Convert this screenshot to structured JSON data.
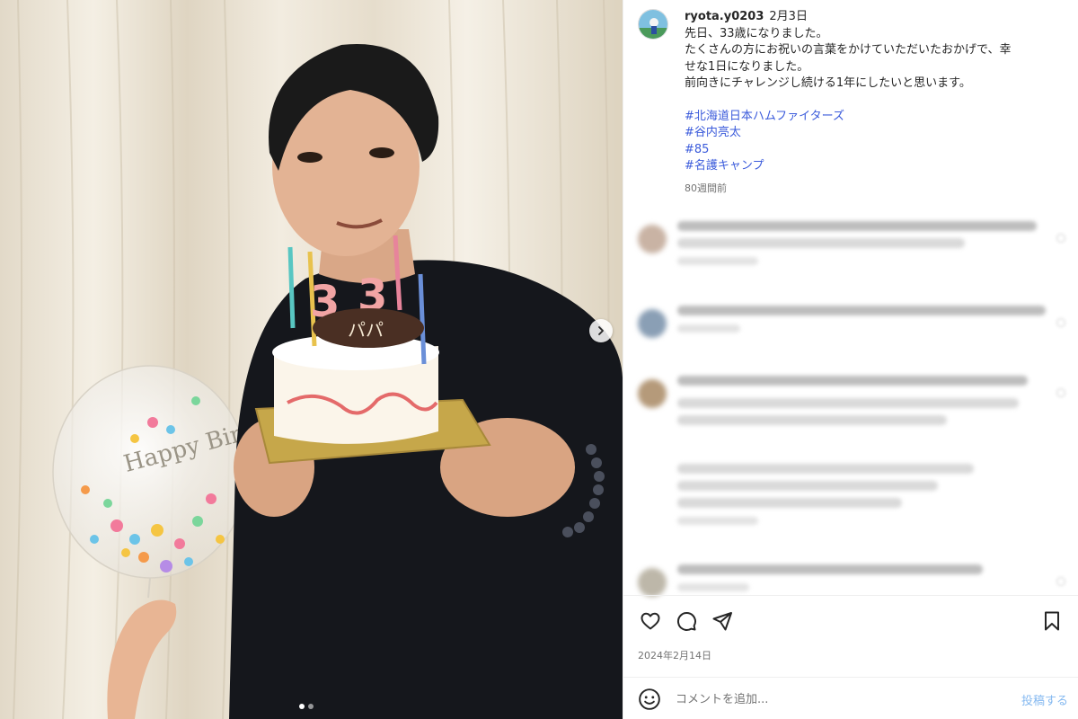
{
  "post": {
    "username": "ryota.y0203",
    "caption_date": "2月3日",
    "caption_lines": [
      "先日、33歳になりました。",
      "たくさんの方にお祝いの言葉をかけていただいたおかげで、幸",
      "せな1日になりました。",
      "前向きにチャレンジし続ける1年にしたいと思います。"
    ],
    "hashtags": [
      "#北海道日本ハムファイターズ",
      "#谷内亮太",
      "#85",
      "#名護キャンプ"
    ],
    "age": "80週間前",
    "date": "2024年2月14日"
  },
  "photo": {
    "cake_plaque": "パパ",
    "candle_digits": [
      "3",
      "3"
    ],
    "balloon_text": "Happy Birthday"
  },
  "comment_bar": {
    "placeholder": "コメントを追加...",
    "post_label": "投稿する"
  },
  "carousel": {
    "total": 2,
    "active": 1
  },
  "icons": [
    "heart-icon",
    "comment-icon",
    "share-icon",
    "bookmark-icon",
    "emoji-icon",
    "chevron-right-icon"
  ],
  "colors": {
    "hashtag": "#3b5bdb",
    "post_button": "#85b9f0",
    "meta_text": "#737373"
  }
}
